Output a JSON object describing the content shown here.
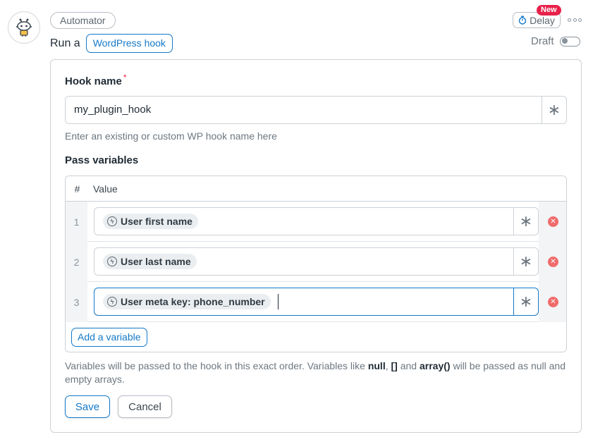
{
  "header": {
    "integration": "Automator",
    "run_prefix": "Run a",
    "trigger_type": "WordPress hook",
    "delay_label": "Delay",
    "new_badge": "New",
    "status_label": "Draft",
    "status_on": false
  },
  "form": {
    "hook_name_label": "Hook name",
    "required_mark": "*",
    "hook_name_value": "my_plugin_hook",
    "hook_name_help": "Enter an existing or custom WP hook name here",
    "pass_variables_label": "Pass variables",
    "table_headers": {
      "num": "#",
      "value": "Value"
    },
    "variables": [
      {
        "num": "1",
        "token": "User first name"
      },
      {
        "num": "2",
        "token": "User last name"
      },
      {
        "num": "3",
        "token": "User meta key: phone_number"
      }
    ],
    "add_variable_label": "Add a variable",
    "info_parts": {
      "a": "Variables will be passed to the hook in this exact order. Variables like ",
      "b": "null",
      "c": ", ",
      "d": "[]",
      "e": " and ",
      "f": "array()",
      "g": " will be passed as null and empty arrays."
    },
    "save_label": "Save",
    "cancel_label": "Cancel"
  },
  "icons": {
    "avatar": "robot-icon",
    "delay": "stopwatch-icon",
    "more": "more-dots-icon",
    "token": "token-bolt-icon",
    "field_picker": "asterisk-icon",
    "remove": "remove-icon"
  },
  "colors": {
    "accent": "#1479c9",
    "new_badge": "#e8214a",
    "remove": "#f06b6b",
    "required": "#e8214a"
  }
}
